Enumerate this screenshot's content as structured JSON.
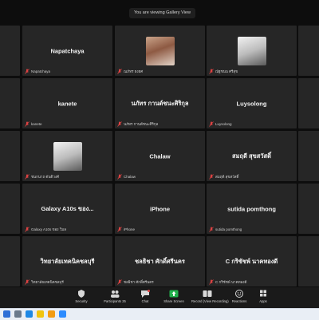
{
  "topbar": {
    "view_badge": "You are viewing Gallery View"
  },
  "tiles": [
    {
      "name": "",
      "footer": "",
      "photo": false
    },
    {
      "name": "Napatchaya",
      "footer": "Napatchaya",
      "photo": false
    },
    {
      "name": "",
      "footer": "ณภัทร ยงยศ",
      "photo": true,
      "photo_palette": "warm"
    },
    {
      "name": "",
      "footer": "ณัฐชนน ศรีสุข",
      "photo": true,
      "photo_palette": "light"
    },
    {
      "name": "",
      "footer": "",
      "photo": false
    },
    {
      "name": "",
      "footer": "",
      "photo": false
    },
    {
      "name": "kanete",
      "footer": "kanete",
      "photo": false
    },
    {
      "name": "นภัทร กานต์ชนะศิริกุล",
      "footer": "นภัทร กานต์ชนะศิริกุล",
      "photo": false
    },
    {
      "name": "Luysolong",
      "footer": "Luysolong",
      "photo": false
    },
    {
      "name": "",
      "footer": "",
      "photo": false
    },
    {
      "name": "",
      "footer": "",
      "photo": false
    },
    {
      "name": "",
      "footer": "ชนกนาถ ตันติวงศ์",
      "photo": true,
      "photo_palette": "light"
    },
    {
      "name": "Chalaw",
      "footer": "Chalaw",
      "photo": false
    },
    {
      "name": "สมฤดี สุขสวัสดิ์",
      "footer": "สมฤดี สุขสวัสดิ์",
      "photo": false
    },
    {
      "name": "",
      "footer": "",
      "photo": false
    },
    {
      "name": "",
      "footer": "",
      "photo": false
    },
    {
      "name": "Galaxy A10s ของ...",
      "footer": "Galaxy A10s ของ วิมล",
      "photo": false
    },
    {
      "name": "iPhone",
      "footer": "iPhone",
      "photo": false
    },
    {
      "name": "sutida pomthong",
      "footer": "sutida pomthong",
      "photo": false
    },
    {
      "name": "",
      "footer": "",
      "photo": false
    },
    {
      "name": "",
      "footer": "",
      "photo": false
    },
    {
      "name": "วิทยาลัยเทคนิคชลบุรี",
      "footer": "วิทยาลัยเทคนิคชลบุรี",
      "photo": false
    },
    {
      "name": "ชลธิชา ศักดิ์ศรีนคร",
      "footer": "ชลธิชา ศักดิ์ศรีนคร",
      "photo": false
    },
    {
      "name": "C กริชัชพ์ นาคทองดี",
      "footer": "C กริชัชพ์ นาคทองดี",
      "photo": false
    },
    {
      "name": "",
      "footer": "",
      "photo": false
    }
  ],
  "toolbar": {
    "security": "Security",
    "participants": "Participants",
    "participants_count": "25",
    "chat": "Chat",
    "chat_count": "5",
    "share_screen": "Share Screen",
    "record": "Record (View Recording)",
    "reactions": "Reactions",
    "apps": "Apps"
  },
  "colors": {
    "tile_bg": "#262626",
    "zoom_bg": "#0d0d0d",
    "share_green": "#22b14c",
    "mic_red": "#e04343"
  }
}
